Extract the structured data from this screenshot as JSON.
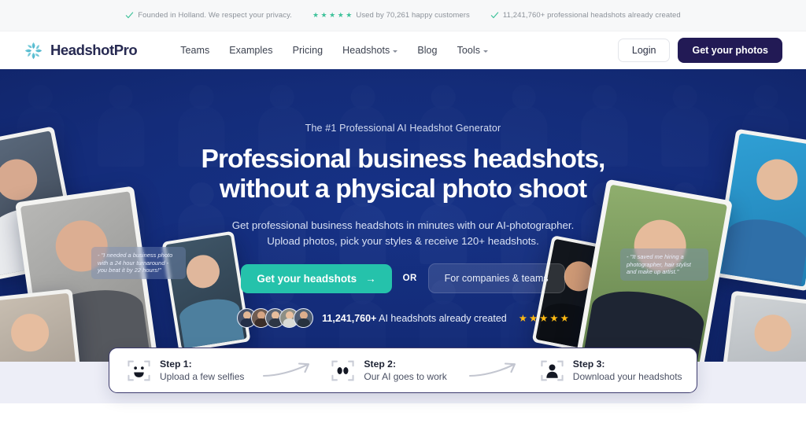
{
  "trustbar": {
    "items": [
      {
        "icon": "check-icon",
        "text": "Founded in Holland. We respect your privacy."
      },
      {
        "icon": "stars-icon",
        "text": "Used by 70,261 happy customers",
        "stars": 5
      },
      {
        "icon": "check-icon",
        "text": "11,241,760+ professional headshots already created"
      }
    ]
  },
  "nav": {
    "brand": "HeadshotPro",
    "links": [
      {
        "label": "Teams",
        "dropdown": false
      },
      {
        "label": "Examples",
        "dropdown": false
      },
      {
        "label": "Pricing",
        "dropdown": false
      },
      {
        "label": "Headshots",
        "dropdown": true
      },
      {
        "label": "Blog",
        "dropdown": false
      },
      {
        "label": "Tools",
        "dropdown": true
      }
    ],
    "login_label": "Login",
    "cta_label": "Get your photos"
  },
  "hero": {
    "eyebrow": "The #1 Professional AI Headshot Generator",
    "headline_line1": "Professional business headshots,",
    "headline_line2": "without a physical photo shoot",
    "sub_line1": "Get professional business headshots in minutes with our AI-photographer.",
    "sub_line2": "Upload photos, pick your styles & receive 120+ headshots.",
    "cta_primary": "Get your headshots",
    "cta_arrow": "→",
    "or_label": "OR",
    "cta_secondary": "For companies & teams",
    "proof_count": "11,241,760+",
    "proof_text": " AI headshots already created",
    "proof_stars": 5,
    "quote_left": "- \"I needed a business photo with a 24 hour turnaround - you beat it by 22 hours!\"",
    "quote_right": "- \"It saved me hiring a photographer, hair stylist and make up artist.\""
  },
  "steps": [
    {
      "icon": "face-scan-icon",
      "title": "Step 1:",
      "desc": "Upload a few selfies"
    },
    {
      "icon": "eyes-scan-icon",
      "title": "Step 2:",
      "desc": "Our AI goes to work"
    },
    {
      "icon": "person-scan-icon",
      "title": "Step 3:",
      "desc": "Download your headshots"
    }
  ],
  "colors": {
    "brand_navy": "#221a55",
    "accent_teal": "#25c2ab",
    "logo_teal": "#4bbfcf",
    "star_gold": "#fdb913",
    "check_green": "#3ec29a",
    "hero_blue": "#1a399a",
    "band_lavender": "#edeef7"
  }
}
